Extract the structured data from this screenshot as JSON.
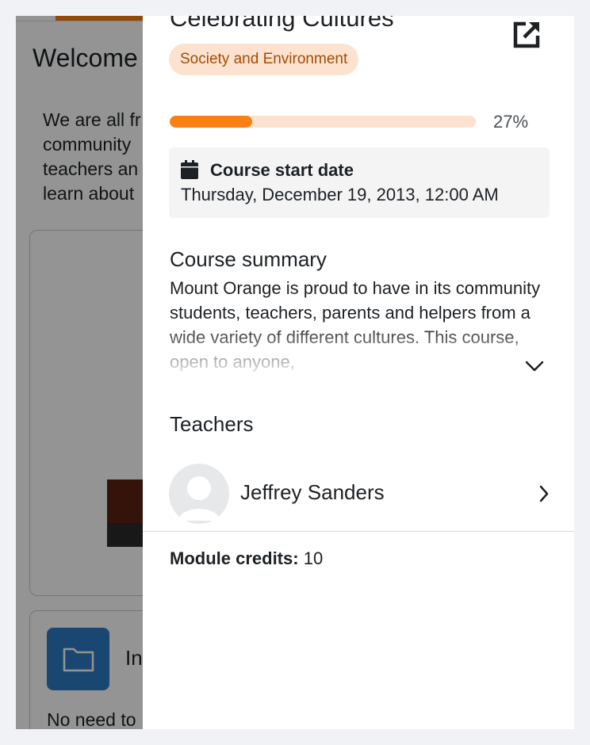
{
  "background": {
    "welcome_heading": "Welcome",
    "intro_lines": [
      "We are all fr",
      "community",
      "teachers an",
      "learn about"
    ],
    "card2_title": "In",
    "card2_text": "No need to"
  },
  "course": {
    "title": "Celebrating Cultures",
    "category": "Society and Environment",
    "progress_percent": 27,
    "progress_text": "27%",
    "start_date_label": "Course start date",
    "start_date_value": "Thursday, December 19, 2013, 12:00 AM",
    "summary_heading": "Course summary",
    "summary_text": "Mount Orange is proud to have in its community students, teachers, parents and helpers from a wide variety of different cultures. This course, open to anyone,",
    "teachers_heading": "Teachers",
    "teachers": [
      {
        "name": "Jeffrey Sanders"
      }
    ],
    "credits_label": "Module credits:",
    "credits_value": "10"
  },
  "icons": {
    "open": "open-in-new-icon",
    "calendar": "calendar-icon",
    "expand": "chevron-down-icon",
    "row_chevron": "chevron-right-icon",
    "folder": "folder-icon",
    "avatar": "user-avatar-placeholder"
  },
  "colors": {
    "accent": "#f98012",
    "badge_bg": "#fde2cf",
    "badge_text": "#a14d06",
    "folder_tile": "#2d7bc3"
  }
}
